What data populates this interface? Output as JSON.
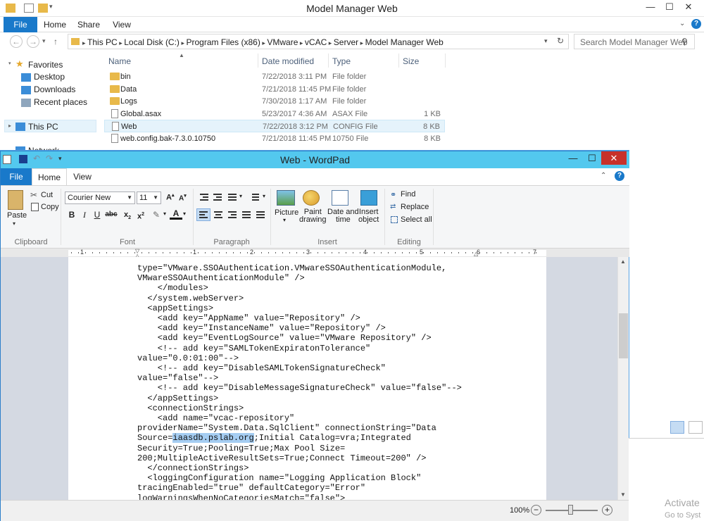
{
  "explorer": {
    "title": "Model Manager Web",
    "tabs": [
      "File",
      "Home",
      "Share",
      "View"
    ],
    "address": [
      "This PC",
      "Local Disk (C:)",
      "Program Files (x86)",
      "VMware",
      "vCAC",
      "Server",
      "Model Manager Web"
    ],
    "search_placeholder": "Search Model Manager Web",
    "nav": {
      "favorites": "Favorites",
      "desktop": "Desktop",
      "downloads": "Downloads",
      "recent": "Recent places",
      "this_pc": "This PC",
      "network": "Network"
    },
    "columns": {
      "name": "Name",
      "date": "Date modified",
      "type": "Type",
      "size": "Size"
    },
    "files": [
      {
        "name": "bin",
        "date": "7/22/2018 3:11 PM",
        "type": "File folder",
        "size": "",
        "icon": "folder"
      },
      {
        "name": "Data",
        "date": "7/21/2018 11:45 PM",
        "type": "File folder",
        "size": "",
        "icon": "folder"
      },
      {
        "name": "Logs",
        "date": "7/30/2018 1:17 AM",
        "type": "File folder",
        "size": "",
        "icon": "folder"
      },
      {
        "name": "Global.asax",
        "date": "5/23/2017 4:36 AM",
        "type": "ASAX File",
        "size": "1 KB",
        "icon": "file"
      },
      {
        "name": "Web",
        "date": "7/22/2018 3:12 PM",
        "type": "CONFIG File",
        "size": "8 KB",
        "icon": "file",
        "selected": true
      },
      {
        "name": "web.config.bak-7.3.0.10750",
        "date": "7/21/2018 11:45 PM",
        "type": "10750 File",
        "size": "8 KB",
        "icon": "file"
      }
    ]
  },
  "wordpad": {
    "title": "Web - WordPad",
    "tabs": {
      "file": "File",
      "home": "Home",
      "view": "View"
    },
    "clipboard": {
      "paste": "Paste",
      "cut": "Cut",
      "copy": "Copy",
      "label": "Clipboard"
    },
    "font": {
      "family": "Courier New",
      "size": "11",
      "label": "Font"
    },
    "paragraph_label": "Paragraph",
    "insert": {
      "picture": "Picture",
      "paint": "Paint\ndrawing",
      "datetime": "Date and\ntime",
      "object": "Insert\nobject",
      "label": "Insert"
    },
    "editing": {
      "find": "Find",
      "replace": "Replace",
      "select_all": "Select all",
      "label": "Editing"
    },
    "ruler_marks": [
      "1",
      "1",
      "2",
      "3",
      "4",
      "5",
      "6",
      "7"
    ],
    "doc_lines": [
      "type=\"VMware.SSOAuthentication.VMwareSSOAuthenticationModule,",
      "VMwareSSOAuthenticationModule\" />",
      "    </modules>",
      "  </system.webServer>",
      "  <appSettings>",
      "    <add key=\"AppName\" value=\"Repository\" />",
      "    <add key=\"InstanceName\" value=\"Repository\" />",
      "    <add key=\"EventLogSource\" value=\"VMware Repository\" />",
      "    <!-- add key=\"SAMLTokenExpiratonTolerance\"",
      "value=\"0.0:01:00\"-->",
      "    <!-- add key=\"DisableSAMLTokenSignatureCheck\"",
      "value=\"false\"-->",
      "    <!-- add key=\"DisableMessageSignatureCheck\" value=\"false\"-->",
      "  </appSettings>",
      "  <connectionStrings>",
      "    <add name=\"vcac-repository\"",
      "providerName=\"System.Data.SqlClient\" connectionString=\"Data",
      "Source=",
      "iaasdb.pslab.org",
      ";Initial Catalog=vra;Integrated",
      "Security=True;Pooling=True;Max Pool Size=",
      "200;MultipleActiveResultSets=True;Connect Timeout=200\" />",
      "  </connectionStrings>",
      "  <loggingConfiguration name=\"Logging Application Block\"",
      "tracingEnabled=\"true\" defaultCategory=\"Error\"",
      "logWarningsWhenNoCategoriesMatch=\"false\">"
    ],
    "zoom": "100%"
  },
  "watermark": {
    "line1": "Activate",
    "line2": "Go to Syst"
  }
}
